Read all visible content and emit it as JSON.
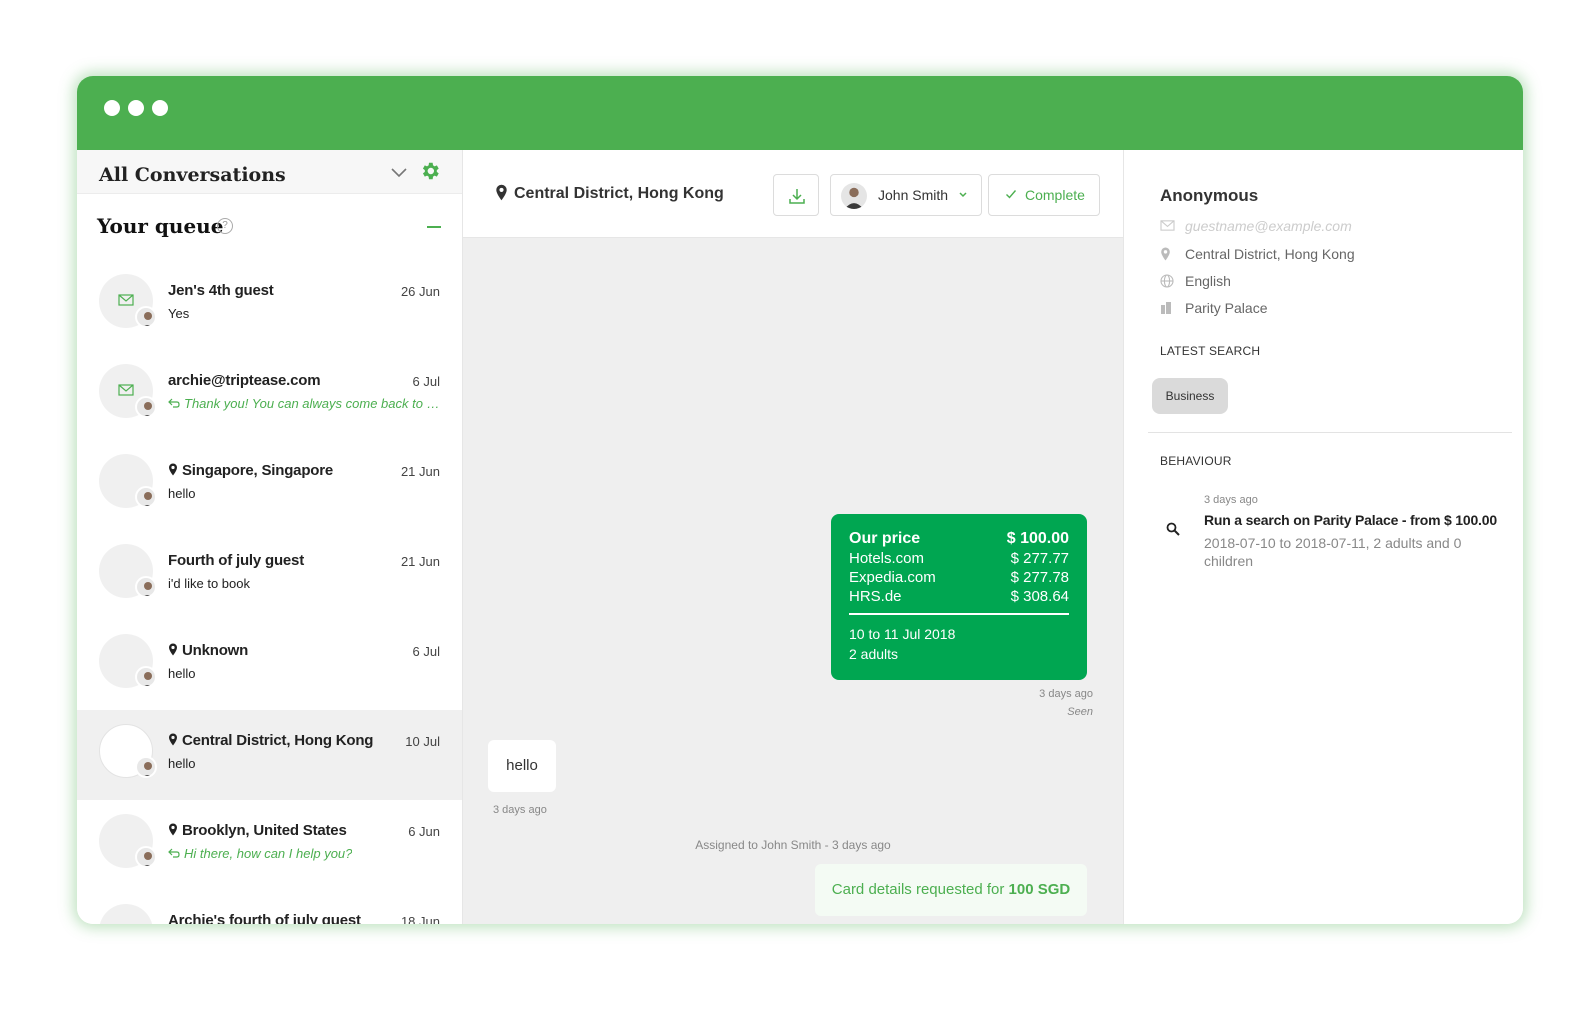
{
  "colors": {
    "brand": "#4caf50",
    "price_card": "#00a651"
  },
  "left_panel": {
    "title": "All Conversations",
    "queue_title": "Your queue",
    "help": "?",
    "conversations": [
      {
        "name": "Jen's 4th guest",
        "date": "26 Jun",
        "preview": "Yes",
        "icon": "mail-icon",
        "reply": false
      },
      {
        "name": "archie@triptease.com",
        "date": "6 Jul",
        "preview": "Thank you! You can always come back to o...",
        "icon": "mail-icon",
        "reply": true
      },
      {
        "name": "Singapore, Singapore",
        "date": "21 Jun",
        "preview": "hello",
        "icon": "pin-icon",
        "reply": false
      },
      {
        "name": "Fourth of july guest",
        "date": "21 Jun",
        "preview": "i'd like to book",
        "icon": "none",
        "reply": false
      },
      {
        "name": "Unknown",
        "date": "6 Jul",
        "preview": "hello",
        "icon": "pin-icon",
        "reply": false
      },
      {
        "name": "Central District, Hong Kong",
        "date": "10 Jul",
        "preview": "hello",
        "icon": "pin-icon",
        "reply": false,
        "active": true
      },
      {
        "name": "Brooklyn, United States",
        "date": "6 Jun",
        "preview": "Hi there, how can I help you?",
        "icon": "pin-icon",
        "reply": true
      },
      {
        "name": "Archie's fourth of july guest",
        "date": "18 Jun",
        "preview": "",
        "icon": "none",
        "reply": false
      }
    ]
  },
  "center": {
    "location": "Central District, Hong Kong",
    "agent": "John Smith",
    "complete_label": "Complete",
    "price_card": {
      "rows": [
        {
          "label": "Our price",
          "value": "$ 100.00"
        },
        {
          "label": "Hotels.com",
          "value": "$ 277.77"
        },
        {
          "label": "Expedia.com",
          "value": "$ 277.78"
        },
        {
          "label": "HRS.de",
          "value": "$ 308.64"
        }
      ],
      "dates": "10 to 11 Jul 2018",
      "guests": "2 adults"
    },
    "out_time": "3 days ago",
    "out_status": "Seen",
    "in_message": "hello",
    "in_time": "3 days ago",
    "assigned": "Assigned to John Smith - 3 days ago",
    "card_request_prefix": "Card details requested for ",
    "card_request_amount": "100 SGD"
  },
  "right": {
    "name": "Anonymous",
    "email_placeholder": "guestname@example.com",
    "location": "Central District, Hong Kong",
    "language": "English",
    "hotel": "Parity Palace",
    "latest_search_label": "LATEST SEARCH",
    "chip": "Business",
    "behaviour_label": "BEHAVIOUR",
    "behaviour": {
      "time": "3 days ago",
      "title": "Run a search on Parity Palace - from $ 100.00",
      "desc": "2018-07-10 to 2018-07-11, 2 adults and 0 children"
    }
  }
}
